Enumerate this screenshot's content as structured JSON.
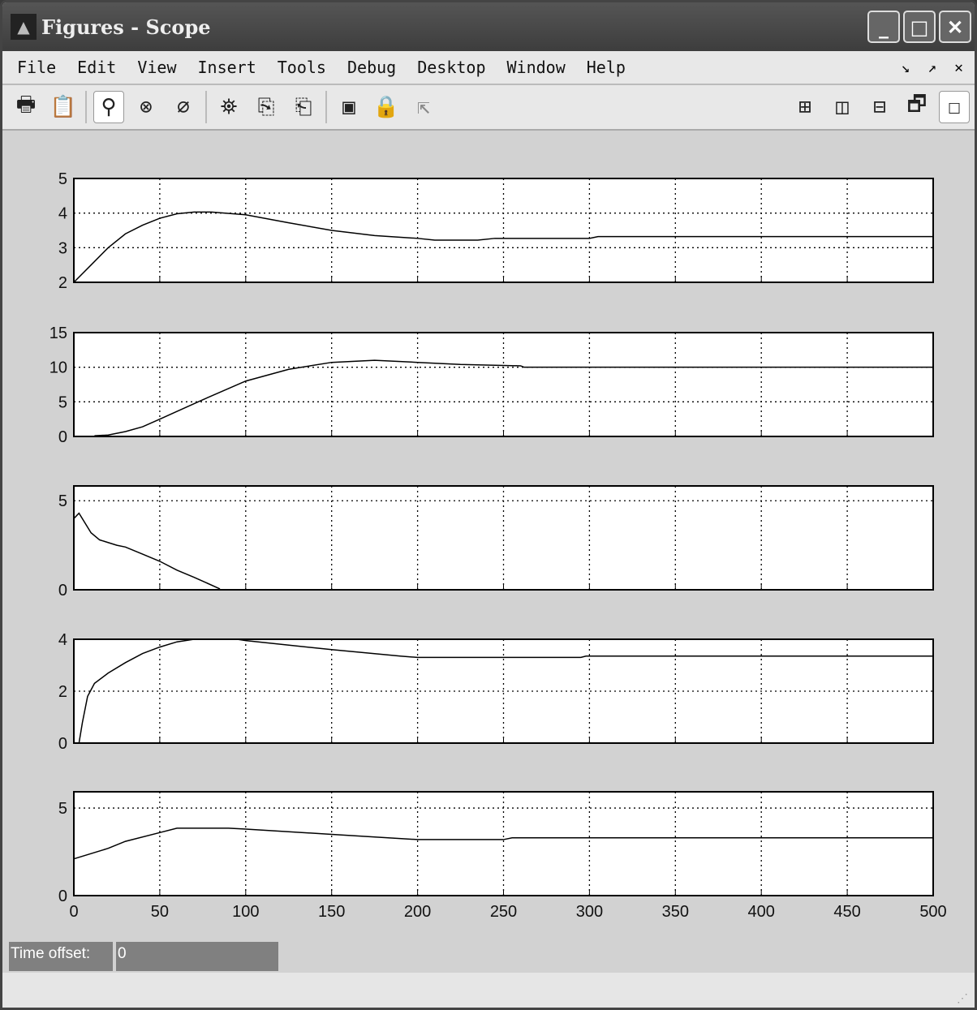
{
  "window": {
    "title": "Figures - Scope",
    "minimize": "_",
    "maximize": "□",
    "close": "✕"
  },
  "menu": [
    "File",
    "Edit",
    "View",
    "Insert",
    "Tools",
    "Debug",
    "Desktop",
    "Window",
    "Help"
  ],
  "menu_right": [
    "↘",
    "↗",
    "✕"
  ],
  "toolbar": [
    {
      "name": "print-icon",
      "glyph": "🖶"
    },
    {
      "name": "clipboard-icon",
      "glyph": "📋"
    },
    {
      "name": "zoom-in-icon",
      "glyph": "⚲",
      "active": true
    },
    {
      "name": "zoom-x-icon",
      "glyph": "⊗"
    },
    {
      "name": "zoom-y-icon",
      "glyph": "⌀"
    },
    {
      "name": "binoculars-icon",
      "glyph": "⛯"
    },
    {
      "name": "save-axes-icon",
      "glyph": "⎘"
    },
    {
      "name": "restore-axes-icon",
      "glyph": "⎗"
    },
    {
      "name": "floating-scope-icon",
      "glyph": "▣"
    },
    {
      "name": "lock-icon",
      "glyph": "🔒",
      "disabled": true
    },
    {
      "name": "signal-selector-icon",
      "glyph": "⇱",
      "disabled": true
    }
  ],
  "layout_buttons": [
    "⊞",
    "◫",
    "⊟",
    "🗗",
    "☐"
  ],
  "status": {
    "time_offset_label": "Time offset:",
    "time_offset_value": "0"
  },
  "chart_data": {
    "type": "line",
    "x_ticks": [
      0,
      50,
      100,
      150,
      200,
      250,
      300,
      350,
      400,
      450,
      500
    ],
    "xlim": [
      0,
      500
    ],
    "grid": true,
    "axes": [
      {
        "ylim": [
          2,
          5
        ],
        "yticks": [
          2,
          3,
          4,
          5
        ],
        "x": [
          0,
          10,
          20,
          30,
          40,
          50,
          60,
          70,
          80,
          100,
          125,
          150,
          175,
          200,
          210,
          235,
          245,
          300,
          305,
          500
        ],
        "y": [
          2,
          2.5,
          3,
          3.4,
          3.65,
          3.85,
          3.98,
          4.03,
          4.03,
          3.95,
          3.72,
          3.5,
          3.35,
          3.27,
          3.22,
          3.22,
          3.27,
          3.27,
          3.32,
          3.32
        ]
      },
      {
        "ylim": [
          0,
          15
        ],
        "yticks": [
          0,
          5,
          10,
          15
        ],
        "x": [
          12,
          20,
          30,
          40,
          50,
          75,
          100,
          125,
          150,
          175,
          200,
          225,
          260,
          262,
          500
        ],
        "y": [
          0.1,
          0.2,
          0.7,
          1.4,
          2.5,
          5.3,
          8,
          9.7,
          10.7,
          11,
          10.7,
          10.4,
          10.2,
          10,
          10
        ]
      },
      {
        "ylim": [
          0,
          5.83
        ],
        "yticks": [
          0,
          5
        ],
        "x": [
          0,
          3,
          10,
          15,
          25,
          30,
          40,
          50,
          60,
          70,
          85
        ],
        "y": [
          4,
          4.3,
          3.2,
          2.8,
          2.5,
          2.4,
          2,
          1.6,
          1.1,
          0.7,
          0.05
        ]
      },
      {
        "ylim": [
          0,
          4
        ],
        "yticks": [
          0,
          2,
          4
        ],
        "x": [
          0,
          3,
          5,
          8,
          12,
          20,
          30,
          40,
          50,
          60,
          70,
          95,
          100,
          150,
          190,
          200,
          295,
          298,
          500
        ],
        "y": [
          0,
          0,
          0.8,
          1.8,
          2.3,
          2.7,
          3.1,
          3.45,
          3.7,
          3.9,
          4,
          4,
          3.95,
          3.6,
          3.35,
          3.3,
          3.3,
          3.35,
          3.35
        ]
      },
      {
        "ylim": [
          0,
          5.93
        ],
        "yticks": [
          0,
          5
        ],
        "x": [
          0,
          20,
          30,
          50,
          60,
          90,
          100,
          150,
          200,
          250,
          255,
          500
        ],
        "y": [
          2.1,
          2.7,
          3.1,
          3.6,
          3.85,
          3.85,
          3.8,
          3.5,
          3.2,
          3.2,
          3.3,
          3.3
        ]
      }
    ]
  }
}
